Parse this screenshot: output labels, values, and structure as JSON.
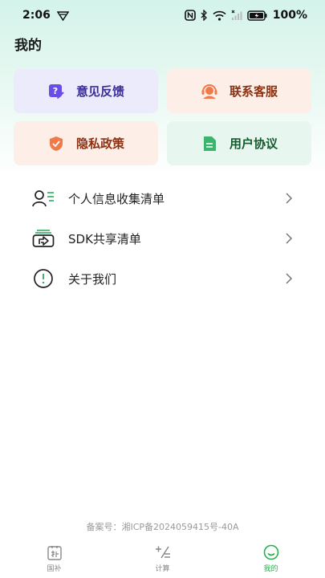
{
  "status_bar": {
    "time": "2:06",
    "battery": "100%"
  },
  "page": {
    "title": "我的"
  },
  "cards": [
    {
      "label": "意见反馈",
      "icon": "feedback-icon",
      "color": "#6b4de6"
    },
    {
      "label": "联系客服",
      "icon": "customer-service-icon",
      "color": "#f07a4a"
    },
    {
      "label": "隐私政策",
      "icon": "shield-icon",
      "color": "#f07a4a"
    },
    {
      "label": "用户协议",
      "icon": "document-icon",
      "color": "#3cb46e"
    }
  ],
  "list": [
    {
      "label": "个人信息收集清单",
      "icon": "user-list-icon"
    },
    {
      "label": "SDK共享清单",
      "icon": "sdk-share-icon"
    },
    {
      "label": "关于我们",
      "icon": "info-icon"
    }
  ],
  "footer": {
    "icp": "备案号：湘ICP备2024059415号-40A"
  },
  "tabs": [
    {
      "label": "国补",
      "icon": "subsidy-icon",
      "active": false
    },
    {
      "label": "计算",
      "icon": "calculator-icon",
      "active": false
    },
    {
      "label": "我的",
      "icon": "smile-icon",
      "active": true
    }
  ],
  "colors": {
    "accent_green": "#27b24e",
    "header_gradient_top": "#d3f3ea"
  }
}
